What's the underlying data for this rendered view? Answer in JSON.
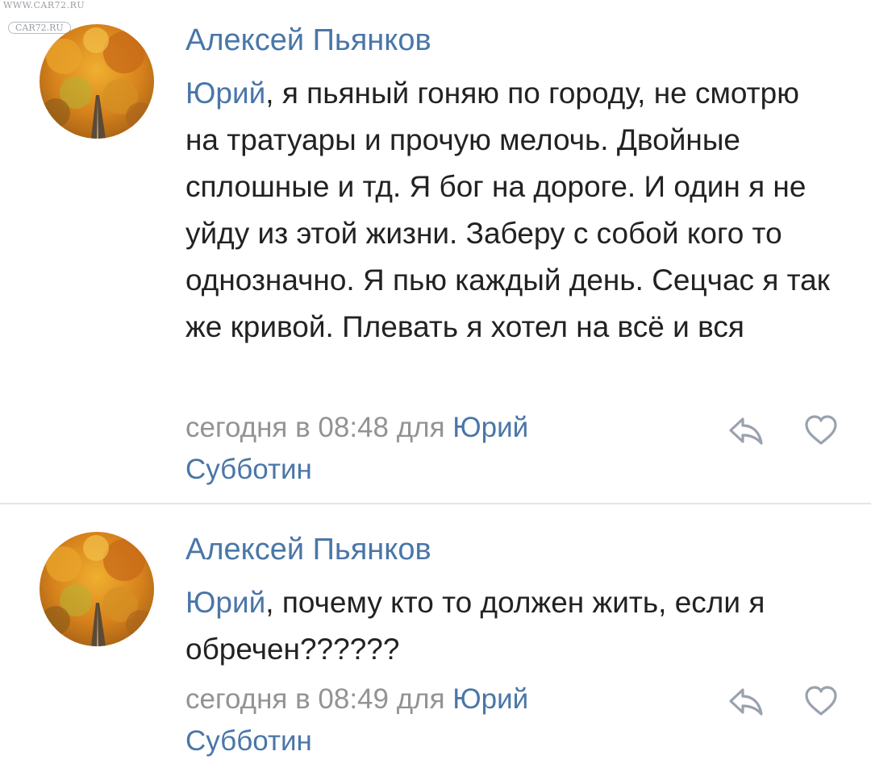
{
  "watermark": {
    "line1": "WWW.CAR72.RU",
    "line2": "CAR72.RU"
  },
  "comments": [
    {
      "author": "Алексей Пьянков",
      "mention": "Юрий",
      "text": ", я пьяный гоняю по городу, не смотрю на тратуары и прочую мелочь. Двойные сплошные и тд. Я бог на дороге. И один я не уйду из этой жизни. Заберу с собой кого то однозначно. Я пью каждый день. Сецчас я так же кривой. Плевать я хотел на всё и вся",
      "timestamp": "сегодня в 08:48",
      "for_label": "для",
      "reply_to": "Юрий Субботин",
      "reply_icon": "reply-arrow-icon",
      "like_icon": "heart-icon"
    },
    {
      "author": "Алексей Пьянков",
      "mention": "Юрий",
      "text": ", почему кто то должен жить, если я обречен??????",
      "timestamp": "сегодня в 08:49",
      "for_label": "для",
      "reply_to": "Юрий Субботин",
      "reply_icon": "reply-arrow-icon",
      "like_icon": "heart-icon"
    }
  ],
  "colors": {
    "link": "#4a76a8",
    "text": "#222222",
    "meta": "#939393",
    "icon": "#99a2ad",
    "divider": "#e3e4e8"
  }
}
